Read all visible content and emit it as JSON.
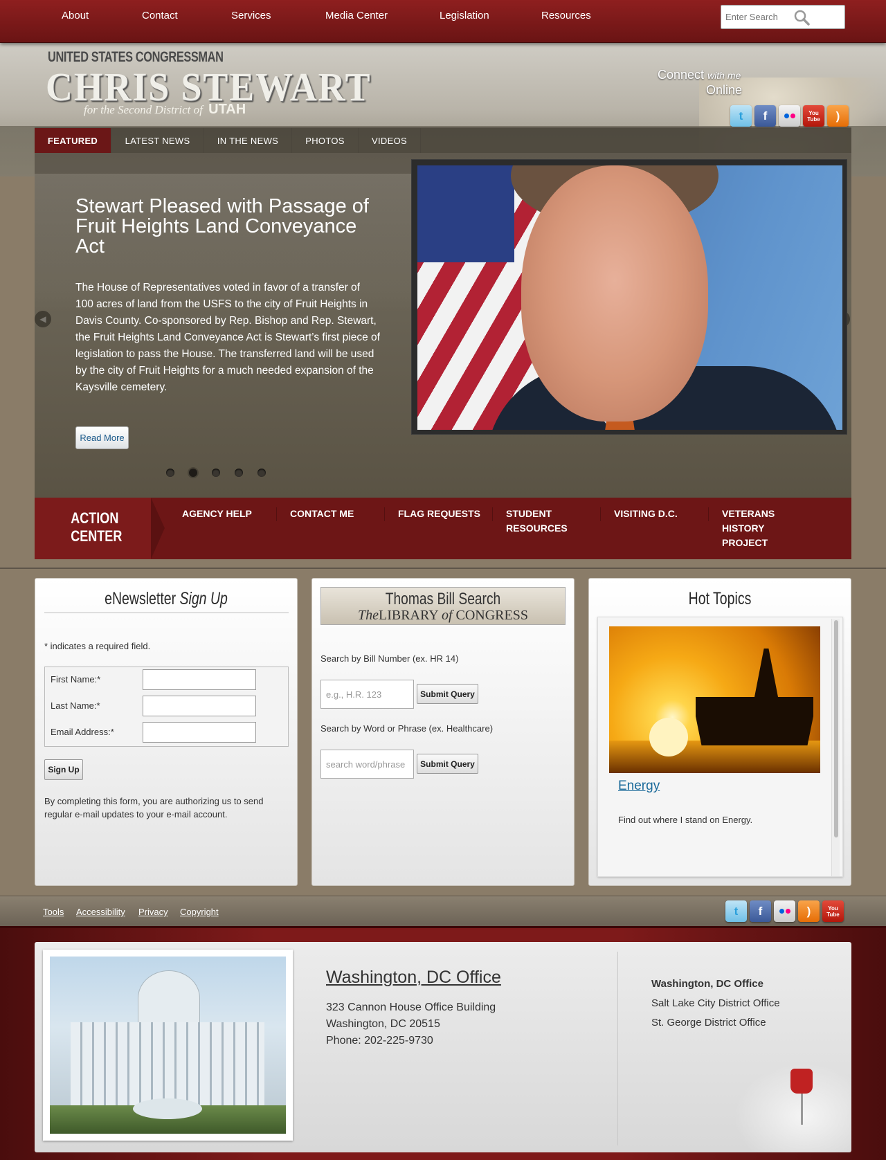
{
  "topnav": {
    "items": [
      "About",
      "Contact",
      "Services",
      "Media Center",
      "Legislation",
      "Resources"
    ],
    "search_placeholder": "Enter Search"
  },
  "header": {
    "kicker": "UNITED STATES CONGRESSMAN",
    "name": "CHRIS STEWART",
    "district": "for the Second District of",
    "state": "UTAH",
    "connect_1": "Connect",
    "connect_with": "with me",
    "connect_2": "Online",
    "social_icons": [
      "twitter-icon",
      "facebook-icon",
      "flickr-icon",
      "youtube-icon",
      "rss-icon"
    ]
  },
  "tabs": [
    "FEATURED",
    "LATEST NEWS",
    "IN THE NEWS",
    "PHOTOS",
    "VIDEOS"
  ],
  "feature": {
    "title": "Stewart Pleased with Passage of Fruit Heights Land Conveyance Act",
    "body": "The House of Representatives voted in favor of a transfer of 100 acres of land from the USFS to the city of Fruit Heights in Davis County. Co-sponsored by Rep. Bishop and Rep. Stewart, the Fruit Heights Land Conveyance Act is Stewart’s first piece of legislation to pass the House. The transferred land will be used by the city of Fruit Heights for a much needed expansion of the Kaysville cemetery.",
    "read_more": "Read More",
    "slide_count": 5,
    "active_slide": 2
  },
  "action_center": {
    "title_1": "ACTION",
    "title_2": "CENTER",
    "links": [
      "AGENCY HELP",
      "CONTACT ME",
      "FLAG REQUESTS",
      "STUDENT RESOURCES",
      "VISITING D.C.",
      "VETERANS HISTORY PROJECT"
    ]
  },
  "newsletter": {
    "title": "eNewsletter",
    "title_em": "Sign Up",
    "required_note": "* indicates a required field.",
    "first_name_label": "First Name:*",
    "last_name_label": "Last Name:*",
    "email_label": "Email Address:*",
    "submit": "Sign Up",
    "disclaimer": "By completing this form, you are authorizing us to send regular e-mail updates to your e-mail account."
  },
  "bill_search": {
    "banner_title": "Thomas Bill Search",
    "banner_the": "The",
    "banner_library": "LIBRARY",
    "banner_of": "of",
    "banner_congress": "CONGRESS",
    "number_label": "Search by Bill Number (ex. HR 14)",
    "number_placeholder": "e.g., H.R. 123",
    "phrase_label": "Search by Word or Phrase (ex. Healthcare)",
    "phrase_placeholder": "search word/phrase",
    "submit": "Submit Query"
  },
  "hot_topics": {
    "title": "Hot Topics",
    "topic": "Energy",
    "description": "Find out where I stand on Energy."
  },
  "footer_links": [
    "Tools",
    "Accessibility",
    "Privacy",
    "Copyright"
  ],
  "footer_social_icons": [
    "twitter-icon",
    "facebook-icon",
    "flickr-icon",
    "rss-icon",
    "youtube-icon"
  ],
  "office": {
    "title": "Washington, DC Office",
    "address_1": "323 Cannon House Office Building",
    "address_2": "Washington, DC 20515",
    "phone": "Phone: 202-225-9730",
    "tabs": [
      "Washington, DC Office",
      "Salt Lake City District Office",
      "St. George District Office"
    ]
  },
  "colors": {
    "brand_red": "#6d1616",
    "link_blue": "#1b5a8a"
  }
}
